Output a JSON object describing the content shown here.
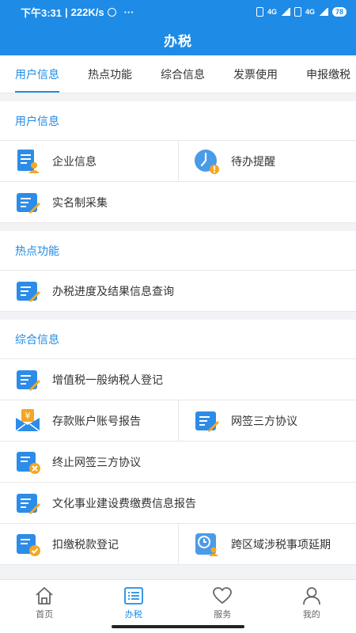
{
  "status_bar": {
    "time": "下午3:31",
    "speed": "222K/s",
    "more": "···",
    "net1": "4G",
    "net2": "4G",
    "battery": "78"
  },
  "header": {
    "title": "办税"
  },
  "tabs": [
    {
      "label": "用户信息",
      "active": true
    },
    {
      "label": "热点功能"
    },
    {
      "label": "综合信息"
    },
    {
      "label": "发票使用"
    },
    {
      "label": "申报缴税"
    }
  ],
  "sections": {
    "user_info": {
      "title": "用户信息",
      "items": {
        "company_info": "企业信息",
        "todo_reminder": "待办提醒",
        "real_name": "实名制采集"
      }
    },
    "hot": {
      "title": "热点功能",
      "items": {
        "progress_query": "办税进度及结果信息查询"
      }
    },
    "general": {
      "title": "综合信息",
      "items": {
        "vat_register": "增值税一般纳税人登记",
        "deposit_report": "存款账户账号报告",
        "online_agreement": "网签三方协议",
        "terminate_agreement": "终止网签三方协议",
        "culture_fee": "文化事业建设费缴费信息报告",
        "withholding": "扣缴税款登记",
        "cross_region": "跨区域涉税事项延期"
      }
    }
  },
  "bottom_nav": [
    {
      "label": "首页",
      "icon": "home-icon"
    },
    {
      "label": "办税",
      "icon": "list-icon",
      "active": true
    },
    {
      "label": "服务",
      "icon": "heart-icon"
    },
    {
      "label": "我的",
      "icon": "user-icon"
    }
  ],
  "colors": {
    "primary": "#1e8be6",
    "orange": "#f5a623",
    "text": "#333333"
  }
}
